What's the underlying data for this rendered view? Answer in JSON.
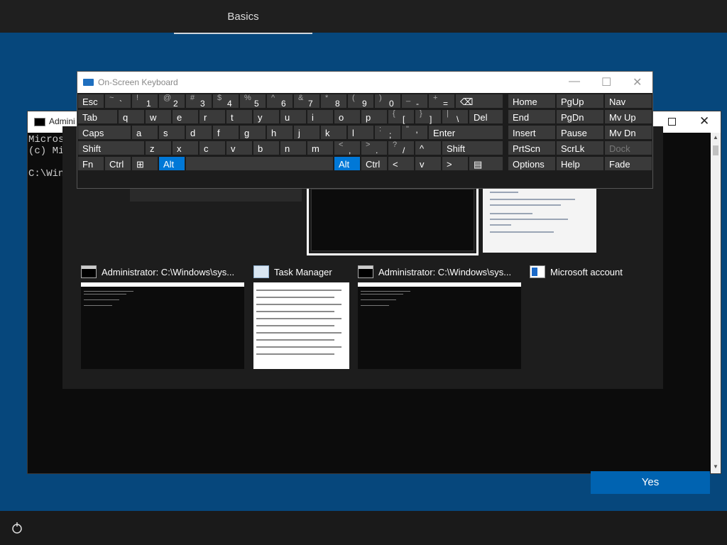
{
  "oobe": {
    "tab_label": "Basics",
    "yes_label": "Yes"
  },
  "cmd_window": {
    "title": "Admini",
    "lines": [
      "Microso",
      "(c) Micr",
      "",
      "C:\\Windo"
    ]
  },
  "osk": {
    "title": "On-Screen Keyboard",
    "minimize": "—",
    "maximize": "☐",
    "close": "✕",
    "row1": [
      {
        "label": "Esc"
      },
      {
        "shift": "~",
        "char": "`"
      },
      {
        "shift": "!",
        "char": "1"
      },
      {
        "shift": "@",
        "char": "2"
      },
      {
        "shift": "#",
        "char": "3"
      },
      {
        "shift": "$",
        "char": "4"
      },
      {
        "shift": "%",
        "char": "5"
      },
      {
        "shift": "^",
        "char": "6"
      },
      {
        "shift": "&",
        "char": "7"
      },
      {
        "shift": "*",
        "char": "8"
      },
      {
        "shift": "(",
        "char": "9"
      },
      {
        "shift": ")",
        "char": "0"
      },
      {
        "shift": "_",
        "char": "-"
      },
      {
        "shift": "+",
        "char": "="
      },
      {
        "label": "⌫"
      }
    ],
    "row2": [
      {
        "label": "Tab"
      },
      {
        "label": "q"
      },
      {
        "label": "w"
      },
      {
        "label": "e"
      },
      {
        "label": "r"
      },
      {
        "label": "t"
      },
      {
        "label": "y"
      },
      {
        "label": "u"
      },
      {
        "label": "i"
      },
      {
        "label": "o"
      },
      {
        "label": "p"
      },
      {
        "shift": "{",
        "char": "["
      },
      {
        "shift": "}",
        "char": "]"
      },
      {
        "shift": "|",
        "char": "\\"
      },
      {
        "label": "Del"
      }
    ],
    "row3": [
      {
        "label": "Caps"
      },
      {
        "label": "a"
      },
      {
        "label": "s"
      },
      {
        "label": "d"
      },
      {
        "label": "f"
      },
      {
        "label": "g"
      },
      {
        "label": "h"
      },
      {
        "label": "j"
      },
      {
        "label": "k"
      },
      {
        "label": "l"
      },
      {
        "shift": ":",
        "char": ";"
      },
      {
        "shift": "\"",
        "char": "'"
      },
      {
        "label": "Enter"
      }
    ],
    "row4": [
      {
        "label": "Shift"
      },
      {
        "label": "z"
      },
      {
        "label": "x"
      },
      {
        "label": "c"
      },
      {
        "label": "v"
      },
      {
        "label": "b"
      },
      {
        "label": "n"
      },
      {
        "label": "m"
      },
      {
        "shift": "<",
        "char": ","
      },
      {
        "shift": ">",
        "char": "."
      },
      {
        "shift": "?",
        "char": "/"
      },
      {
        "label": "^"
      },
      {
        "label": "Shift"
      }
    ],
    "row5": [
      {
        "label": "Fn"
      },
      {
        "label": "Ctrl"
      },
      {
        "label": "⊞"
      },
      {
        "label": "Alt"
      },
      {
        "label": ""
      },
      {
        "label": "Alt"
      },
      {
        "label": "Ctrl"
      },
      {
        "label": "<"
      },
      {
        "label": "v"
      },
      {
        "label": ">"
      },
      {
        "label": "▤"
      }
    ],
    "nav_keys": [
      [
        "Home",
        "PgUp",
        "Nav"
      ],
      [
        "End",
        "PgDn",
        "Mv Up"
      ],
      [
        "Insert",
        "Pause",
        "Mv Dn"
      ],
      [
        "PrtScn",
        "ScrLk",
        "Dock"
      ],
      [
        "Options",
        "Help",
        "Fade"
      ]
    ]
  },
  "switcher": {
    "items": [
      {
        "title": "Administrator: C:\\Windows\\sys...",
        "icon": "cmd-icon"
      },
      {
        "title": "Task Manager",
        "icon": "task-manager-icon"
      },
      {
        "title": "Administrator: C:\\Windows\\sys...",
        "icon": "cmd-icon"
      },
      {
        "title": "Microsoft account",
        "icon": "microsoft-account-icon"
      }
    ]
  },
  "colors": {
    "accent": "#0078d7",
    "oobe_bg": "#06477c",
    "key_bg": "#3a3a3a"
  }
}
